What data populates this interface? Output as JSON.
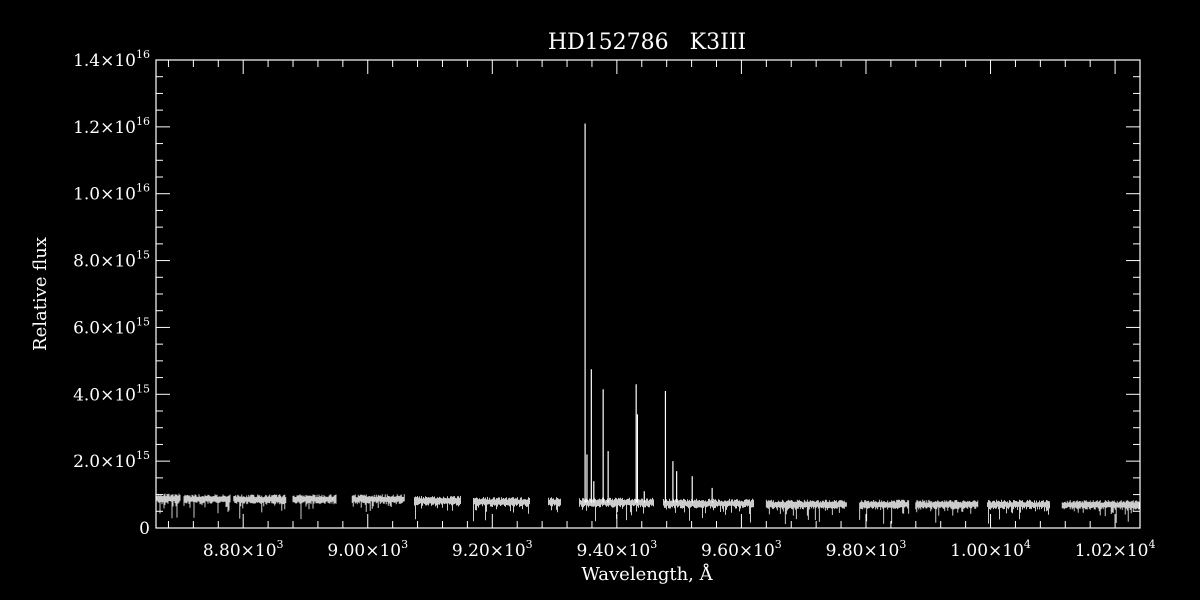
{
  "chart_data": {
    "type": "line",
    "title": "HD152786   K3III",
    "xlabel": "Wavelength, Å",
    "ylabel": "Relative flux",
    "xlim": [
      8660,
      10240
    ],
    "ylim": [
      0,
      1.4e+16
    ],
    "colors": {
      "background": "#000000",
      "foreground": "#ffffff"
    },
    "x_ticks": [
      {
        "value": 8800,
        "mantissa": "8.80",
        "exponent": "3"
      },
      {
        "value": 9000,
        "mantissa": "9.00",
        "exponent": "3"
      },
      {
        "value": 9200,
        "mantissa": "9.20",
        "exponent": "3"
      },
      {
        "value": 9400,
        "mantissa": "9.40",
        "exponent": "3"
      },
      {
        "value": 9600,
        "mantissa": "9.60",
        "exponent": "3"
      },
      {
        "value": 9800,
        "mantissa": "9.80",
        "exponent": "3"
      },
      {
        "value": 10000,
        "mantissa": "1.00",
        "exponent": "4"
      },
      {
        "value": 10200,
        "mantissa": "1.02",
        "exponent": "4"
      }
    ],
    "y_ticks": [
      {
        "value": 0,
        "mantissa": "0",
        "exponent": ""
      },
      {
        "value": 2000000000000000.0,
        "mantissa": "2.0",
        "exponent": "15"
      },
      {
        "value": 4000000000000000.0,
        "mantissa": "4.0",
        "exponent": "15"
      },
      {
        "value": 6000000000000000.0,
        "mantissa": "6.0",
        "exponent": "15"
      },
      {
        "value": 8000000000000000.0,
        "mantissa": "8.0",
        "exponent": "15"
      },
      {
        "value": 1e+16,
        "mantissa": "1.0",
        "exponent": "16"
      },
      {
        "value": 1.2e+16,
        "mantissa": "1.2",
        "exponent": "16"
      },
      {
        "value": 1.4e+16,
        "mantissa": "1.4",
        "exponent": "16"
      }
    ],
    "segments": [
      {
        "x_start": 8660,
        "x_end": 8700,
        "level": 880000000000000.0
      },
      {
        "x_start": 8705,
        "x_end": 8780,
        "level": 860000000000000.0
      },
      {
        "x_start": 8785,
        "x_end": 8870,
        "level": 860000000000000.0
      },
      {
        "x_start": 8880,
        "x_end": 8950,
        "level": 860000000000000.0
      },
      {
        "x_start": 8975,
        "x_end": 9060,
        "level": 860000000000000.0
      },
      {
        "x_start": 9075,
        "x_end": 9150,
        "level": 810000000000000.0
      },
      {
        "x_start": 9170,
        "x_end": 9260,
        "level": 780000000000000.0
      },
      {
        "x_start": 9290,
        "x_end": 9310,
        "level": 780000000000000.0
      },
      {
        "x_start": 9340,
        "x_end": 9460,
        "level": 760000000000000.0
      },
      {
        "x_start": 9475,
        "x_end": 9620,
        "level": 730000000000000.0
      },
      {
        "x_start": 9640,
        "x_end": 9770,
        "level": 700000000000000.0
      },
      {
        "x_start": 9790,
        "x_end": 9870,
        "level": 700000000000000.0
      },
      {
        "x_start": 9880,
        "x_end": 9980,
        "level": 700000000000000.0
      },
      {
        "x_start": 9995,
        "x_end": 10095,
        "level": 700000000000000.0
      },
      {
        "x_start": 10115,
        "x_end": 10240,
        "level": 690000000000000.0
      }
    ],
    "emission_spikes": [
      {
        "x": 9349,
        "y": 1.21e+16
      },
      {
        "x": 9352,
        "y": 2200000000000000.0
      },
      {
        "x": 9359,
        "y": 4750000000000000.0
      },
      {
        "x": 9363,
        "y": 1400000000000000.0
      },
      {
        "x": 9378,
        "y": 4150000000000000.0
      },
      {
        "x": 9386,
        "y": 2300000000000000.0
      },
      {
        "x": 9431,
        "y": 4300000000000000.0
      },
      {
        "x": 9433,
        "y": 3400000000000000.0
      },
      {
        "x": 9444,
        "y": 1100000000000000.0
      },
      {
        "x": 9478,
        "y": 4100000000000000.0
      },
      {
        "x": 9490,
        "y": 2000000000000000.0
      },
      {
        "x": 9496,
        "y": 1700000000000000.0
      },
      {
        "x": 9521,
        "y": 1550000000000000.0
      },
      {
        "x": 9553,
        "y": 1200000000000000.0
      }
    ]
  }
}
